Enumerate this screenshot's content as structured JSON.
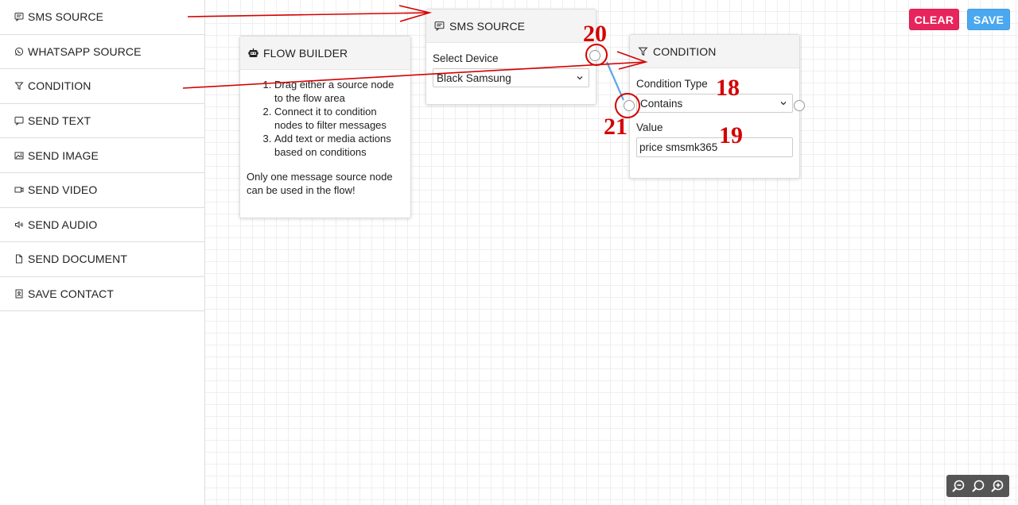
{
  "sidebar": {
    "items": [
      {
        "label": "SMS SOURCE",
        "icon": "sms-icon"
      },
      {
        "label": "WHATSAPP SOURCE",
        "icon": "whatsapp-icon"
      },
      {
        "label": "CONDITION",
        "icon": "filter-icon"
      },
      {
        "label": "SEND TEXT",
        "icon": "message-icon"
      },
      {
        "label": "SEND IMAGE",
        "icon": "image-icon"
      },
      {
        "label": "SEND VIDEO",
        "icon": "video-icon"
      },
      {
        "label": "SEND AUDIO",
        "icon": "audio-icon"
      },
      {
        "label": "SEND DOCUMENT",
        "icon": "document-icon"
      },
      {
        "label": "SAVE CONTACT",
        "icon": "contact-icon"
      }
    ]
  },
  "toolbar": {
    "clear_label": "CLEAR",
    "save_label": "SAVE",
    "clear_color": "#e8245c",
    "save_color": "#4aa8f0"
  },
  "flow_builder": {
    "title": "FLOW BUILDER",
    "icon": "robot-icon",
    "steps": [
      "Drag either a source node to the flow area",
      "Connect it to condition nodes to filter messages",
      "Add text or media actions based on conditions"
    ],
    "note": "Only one message source node can be used in the flow!"
  },
  "sms_node": {
    "title": "SMS SOURCE",
    "icon": "sms-icon",
    "device_label": "Select Device",
    "device_value": "Black Samsung"
  },
  "condition_node": {
    "title": "CONDITION",
    "icon": "filter-icon",
    "type_label": "Condition Type",
    "type_value": "Contains",
    "value_label": "Value",
    "value_value": "price smsmk365"
  },
  "annotations": {
    "n18": "18",
    "n19": "19",
    "n20": "20",
    "n21": "21",
    "color": "#d40000"
  },
  "zoom": {
    "icons": [
      "zoom-out-icon",
      "zoom-reset-icon",
      "zoom-in-icon"
    ]
  }
}
